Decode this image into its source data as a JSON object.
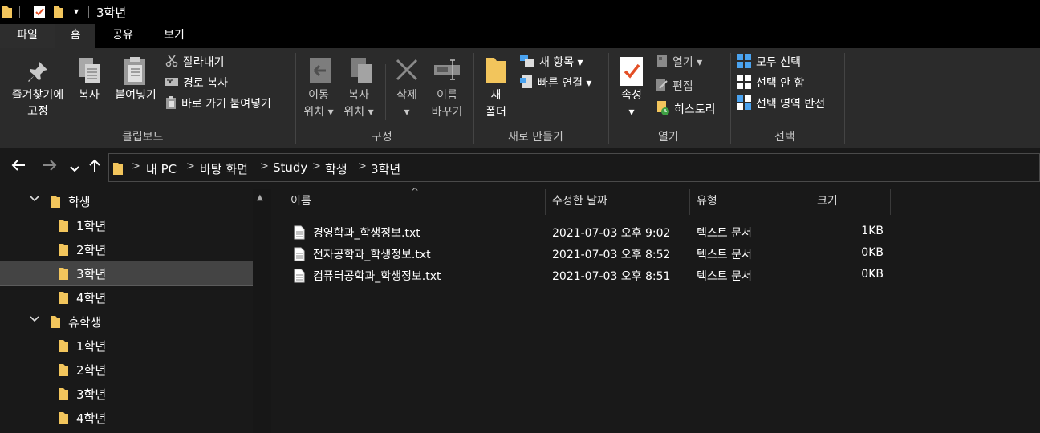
{
  "window": {
    "title": "3학년",
    "qat_dropdown": "▾"
  },
  "ribbon": {
    "tabs": [
      "파일",
      "홈",
      "공유",
      "보기"
    ],
    "clipboard": {
      "label": "클립보드",
      "pin_line1": "즐겨찾기에",
      "pin_line2": "고정",
      "copy": "복사",
      "paste": "붙여넣기",
      "cut": "잘라내기",
      "copy_path": "경로 복사",
      "paste_shortcut": "바로 가기 붙여넣기"
    },
    "organize": {
      "label": "구성",
      "move_line1": "이동",
      "move_line2": "위치",
      "copyto_line1": "복사",
      "copyto_line2": "위치",
      "delete": "삭제",
      "rename_line1": "이름",
      "rename_line2": "바꾸기"
    },
    "new": {
      "label": "새로 만들기",
      "newfolder_line1": "새",
      "newfolder_line2": "폴더",
      "new_item": "새 항목",
      "easy_access": "빠른 연결"
    },
    "open": {
      "label": "열기",
      "properties": "속성",
      "open": "열기",
      "edit": "편집",
      "history": "히스토리"
    },
    "select": {
      "label": "선택",
      "select_all": "모두 선택",
      "select_none": "선택 안 함",
      "invert": "선택 영역 반전"
    }
  },
  "address": {
    "crumbs": [
      "내 PC",
      "바탕 화면",
      "Study",
      "학생",
      "3학년"
    ]
  },
  "nav_tree": [
    {
      "label": "학생",
      "level": 0,
      "expanded": true
    },
    {
      "label": "1학년",
      "level": 1
    },
    {
      "label": "2학년",
      "level": 1
    },
    {
      "label": "3학년",
      "level": 1,
      "selected": true
    },
    {
      "label": "4학년",
      "level": 1
    },
    {
      "label": "휴학생",
      "level": 0,
      "expanded": true
    },
    {
      "label": "1학년",
      "level": 1
    },
    {
      "label": "2학년",
      "level": 1
    },
    {
      "label": "3학년",
      "level": 1
    },
    {
      "label": "4학년",
      "level": 1
    }
  ],
  "columns": {
    "name": "이름",
    "modified": "수정한 날짜",
    "type": "유형",
    "size": "크기",
    "sort_indicator": "^"
  },
  "files": [
    {
      "name": "경영학과_학생정보.txt",
      "modified": "2021-07-03 오후 9:02",
      "type": "텍스트 문서",
      "size": "1KB"
    },
    {
      "name": "전자공학과_학생정보.txt",
      "modified": "2021-07-03 오후 8:52",
      "type": "텍스트 문서",
      "size": "0KB"
    },
    {
      "name": "컴퓨터공학과_학생정보.txt",
      "modified": "2021-07-03 오후 8:51",
      "type": "텍스트 문서",
      "size": "0KB"
    }
  ],
  "colors": {
    "folder": "#f2c55c",
    "accent_check": "#e34f26",
    "select_blue": "#4aa3f0"
  }
}
